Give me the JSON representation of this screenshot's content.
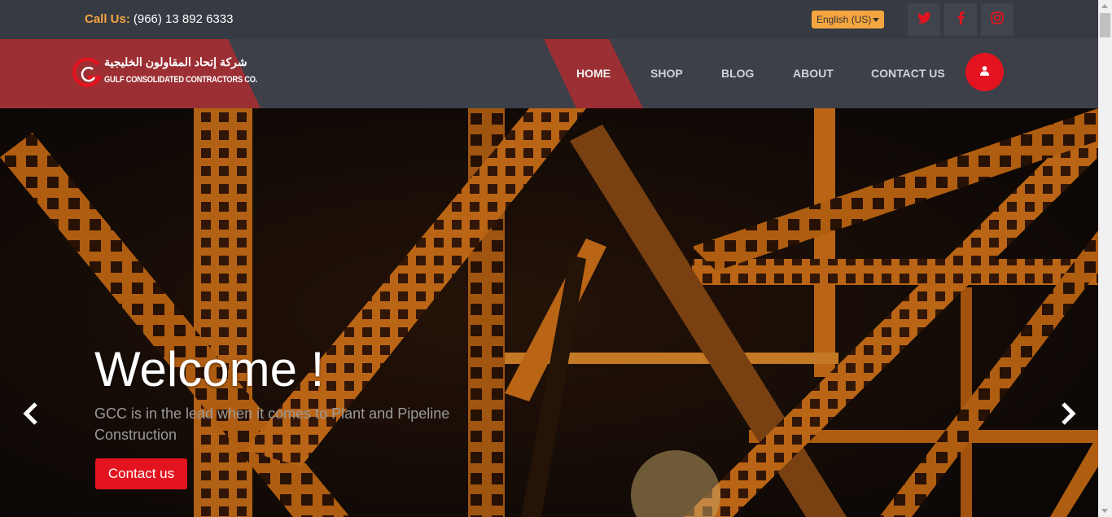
{
  "topbar": {
    "call_label": "Call Us:",
    "call_number": "(966) 13 892 6333",
    "language": "English (US)",
    "social": [
      {
        "name": "twitter-icon",
        "color": "#e3141f"
      },
      {
        "name": "facebook-icon",
        "color": "#e3141f"
      },
      {
        "name": "instagram-icon",
        "color": "#e3141f"
      }
    ]
  },
  "logo": {
    "arabic": "شركة إتحاد المقاولون الخليجية",
    "english": "GULF CONSOLIDATED CONTRACTORS CO."
  },
  "nav": {
    "items": [
      "HOME",
      "SHOP",
      "BLOG",
      "ABOUT",
      "CONTACT US"
    ],
    "active": "HOME",
    "user_icon": "user-icon"
  },
  "hero": {
    "title": "Welcome !",
    "subtitle": "GCC is in the lead when it comes to Plant and Pipeline Construction",
    "button": "Contact us",
    "prev_icon": "chevron-left-icon",
    "next_icon": "chevron-right-icon"
  },
  "colors": {
    "accent": "#e3141f",
    "brand_red": "#9c2f33",
    "topbar": "#363a42",
    "navbar": "#3d4048",
    "call_label": "#f5a540"
  }
}
